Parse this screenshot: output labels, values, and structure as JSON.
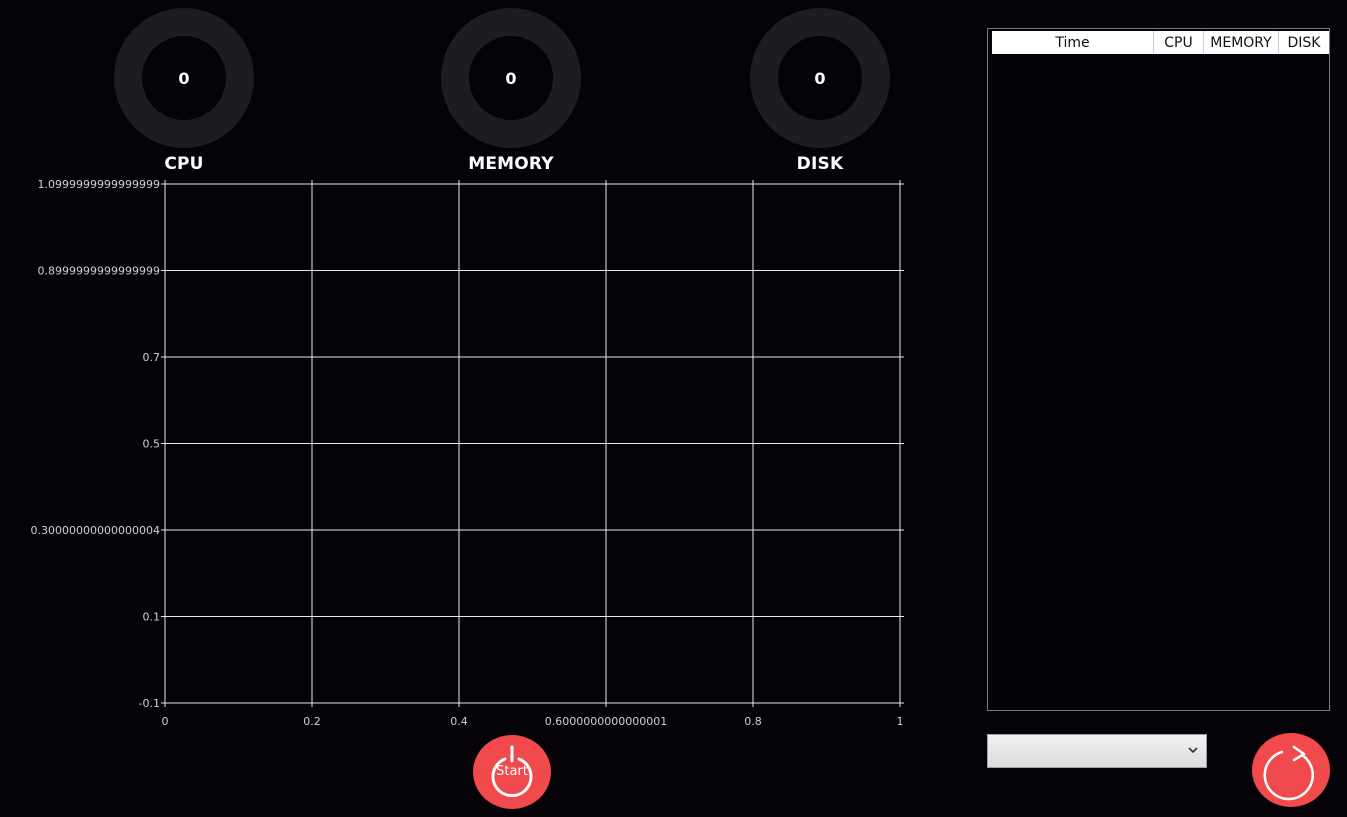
{
  "gauges": {
    "cpu": {
      "value": "0",
      "label": "CPU"
    },
    "memory": {
      "value": "0",
      "label": "MEMORY"
    },
    "disk": {
      "value": "0",
      "label": "DISK"
    }
  },
  "chart_data": {
    "type": "line",
    "title": "",
    "xlabel": "",
    "ylabel": "",
    "x_ticks": [
      "0",
      "0.2",
      "0.4",
      "0.6000000000000001",
      "0.8",
      "1"
    ],
    "y_ticks": [
      "-0.1",
      "0.1",
      "0.30000000000000004",
      "0.5",
      "0.7",
      "0.8999999999999999",
      "1.0999999999999999"
    ],
    "xlim": [
      0,
      1
    ],
    "ylim": [
      -0.1,
      1.1
    ],
    "grid": true,
    "series": []
  },
  "start_button": {
    "label": "Start"
  },
  "table": {
    "columns": [
      "Time",
      "CPU",
      "MEMORY",
      "DISK"
    ],
    "rows": []
  },
  "dropdown": {
    "selected": ""
  },
  "colors": {
    "background": "#050307",
    "gauge_ring": "#1d1c20",
    "accent": "#f04a4c",
    "grid": "#e8e8e8"
  },
  "icons": {
    "start": "power-icon",
    "refresh": "refresh-icon",
    "dropdown": "chevron-down-icon"
  }
}
